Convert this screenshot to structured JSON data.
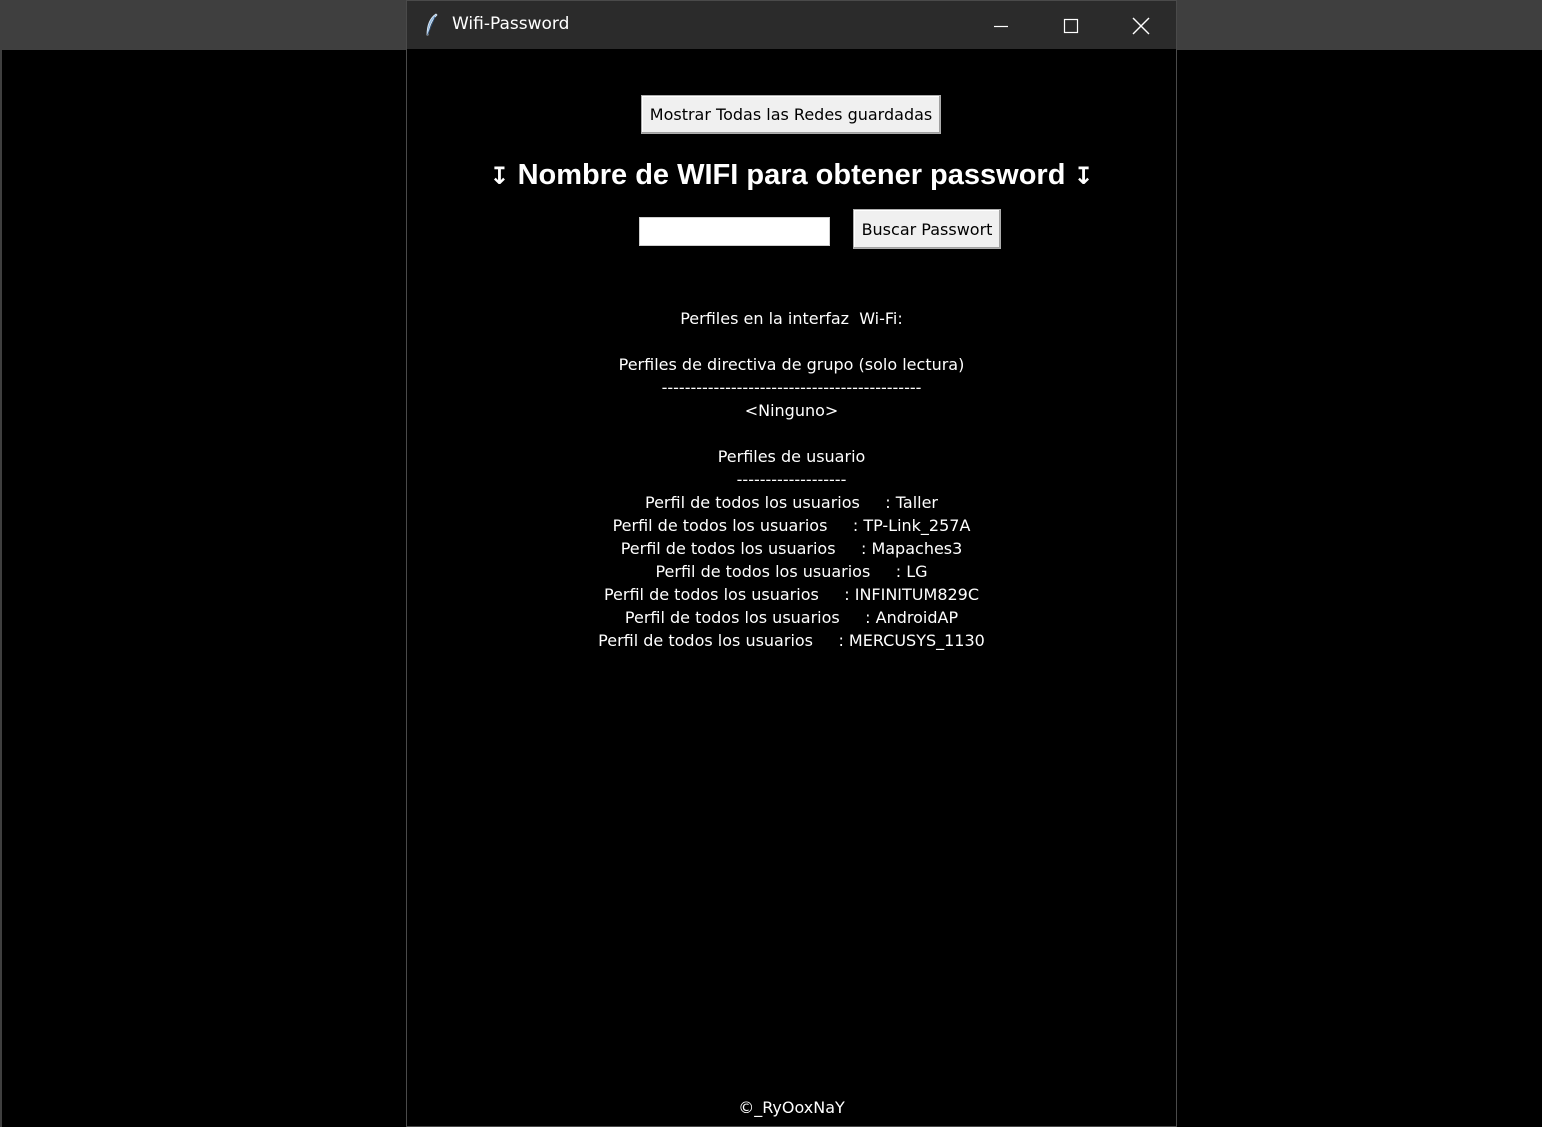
{
  "window": {
    "title": "Wifi-Password"
  },
  "buttons": {
    "show_all": "Mostrar Todas las Redes guardadas",
    "search": "Buscar Passwort"
  },
  "heading": {
    "arrow_left": "↧",
    "text": "Nombre de WIFI para obtener password",
    "arrow_right": "↧"
  },
  "input": {
    "value": "",
    "placeholder": ""
  },
  "output": {
    "interface_header": "Perfiles en la interfaz  Wi-Fi:",
    "group_header": "Perfiles de directiva de grupo (solo lectura)",
    "group_divider": "---------------------------------------------",
    "group_none": "<Ninguno>",
    "user_header": "Perfiles de usuario",
    "user_divider": "-------------------",
    "profiles": [
      "Perfil de todos los usuarios     : Taller",
      "Perfil de todos los usuarios     : TP-Link_257A",
      "Perfil de todos los usuarios     : Mapaches3",
      "Perfil de todos los usuarios     : LG",
      "Perfil de todos los usuarios     : INFINITUM829C",
      "Perfil de todos los usuarios     : AndroidAP",
      "Perfil de todos los usuarios     : MERCUSYS_1130"
    ]
  },
  "footer": {
    "credit": "©_RyOoxNaY"
  },
  "colors": {
    "background": "#000000",
    "titlebar": "#2b2b2b",
    "text": "#ffffff",
    "button": "#f0f0f0"
  }
}
